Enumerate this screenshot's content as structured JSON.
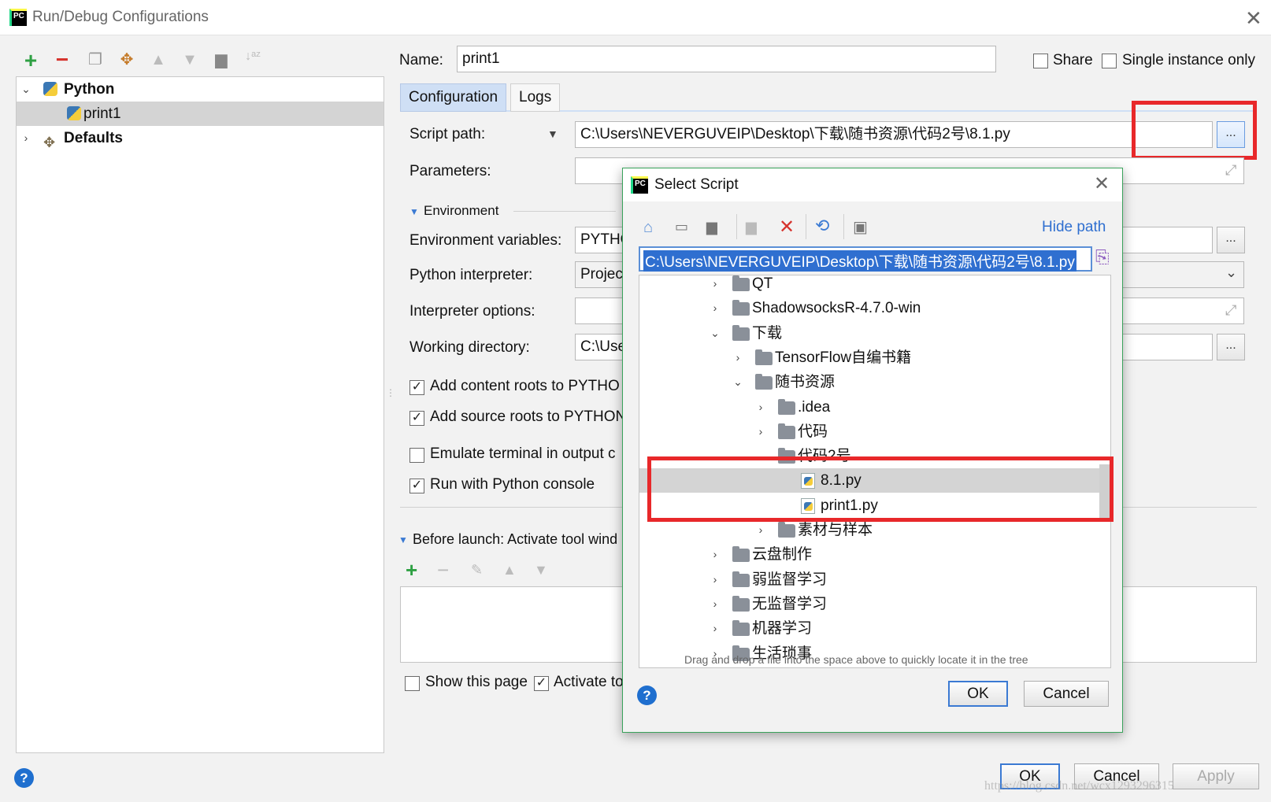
{
  "window": {
    "title": "Run/Debug Configurations"
  },
  "toolbar": {
    "icons": [
      "add-icon",
      "remove-icon",
      "copy-icon",
      "wrench-icon",
      "move-up-icon",
      "move-down-icon",
      "folder-icon",
      "sort-icon"
    ]
  },
  "tree": {
    "python": "Python",
    "print1": "print1",
    "defaults": "Defaults"
  },
  "name": {
    "label": "Name:",
    "value": "print1"
  },
  "share": {
    "label": "Share"
  },
  "single_instance": {
    "label": "Single instance only"
  },
  "tabs": {
    "configuration": "Configuration",
    "logs": "Logs"
  },
  "form": {
    "script_path_label": "Script path:",
    "script_path_value": "C:\\Users\\NEVERGUVEIP\\Desktop\\下载\\随书资源\\代码2号\\8.1.py",
    "parameters_label": "Parameters:",
    "environment_label": "Environment",
    "env_vars_label": "Environment variables:",
    "env_vars_value": "PYTHO",
    "interpreter_label": "Python interpreter:",
    "interpreter_value": "Projec",
    "interp_options_label": "Interpreter options:",
    "working_dir_label": "Working directory:",
    "working_dir_value": "C:\\Use",
    "add_content_roots": "Add content roots to PYTHO",
    "add_source_roots": "Add source roots to PYTHON",
    "emulate_terminal": "Emulate terminal in output c",
    "run_with_console": "Run with Python console",
    "before_launch": "Before launch: Activate tool wind",
    "show_this_page": "Show this page",
    "activate_tool": "Activate to"
  },
  "buttons": {
    "ok": "OK",
    "cancel": "Cancel",
    "apply": "Apply",
    "dots": "..."
  },
  "watermark": "https://blog.csdn.net/wcx1293296315",
  "dialog": {
    "title": "Select Script",
    "hide_path": "Hide path",
    "path_value": "C:\\Users\\NEVERGUVEIP\\Desktop\\下载\\随书资源\\代码2号\\8.1.py",
    "hint": "Drag and drop a file into the space above to quickly locate it in the tree",
    "ok": "OK",
    "cancel": "Cancel",
    "rows": [
      {
        "label": "QT",
        "type": "folder",
        "depth": 0,
        "state": "collapsed"
      },
      {
        "label": "ShadowsocksR-4.7.0-win",
        "type": "folder",
        "depth": 0,
        "state": "collapsed"
      },
      {
        "label": "下载",
        "type": "folder",
        "depth": 0,
        "state": "expanded"
      },
      {
        "label": "TensorFlow自编书籍",
        "type": "folder",
        "depth": 1,
        "state": "collapsed"
      },
      {
        "label": "随书资源",
        "type": "folder",
        "depth": 1,
        "state": "expanded"
      },
      {
        "label": ".idea",
        "type": "folder",
        "depth": 2,
        "state": "collapsed"
      },
      {
        "label": "代码",
        "type": "folder",
        "depth": 2,
        "state": "collapsed"
      },
      {
        "label": "代码2号",
        "type": "folder",
        "depth": 2,
        "state": "expanded"
      },
      {
        "label": "8.1.py",
        "type": "file",
        "depth": 3,
        "state": "selected"
      },
      {
        "label": "print1.py",
        "type": "file",
        "depth": 3,
        "state": "none"
      },
      {
        "label": "素材与样本",
        "type": "folder",
        "depth": 2,
        "state": "collapsed"
      },
      {
        "label": "云盘制作",
        "type": "folder",
        "depth": 0,
        "state": "collapsed"
      },
      {
        "label": "弱监督学习",
        "type": "folder",
        "depth": 0,
        "state": "collapsed"
      },
      {
        "label": "无监督学习",
        "type": "folder",
        "depth": 0,
        "state": "collapsed"
      },
      {
        "label": "机器学习",
        "type": "folder",
        "depth": 0,
        "state": "collapsed"
      },
      {
        "label": "生活琐事",
        "type": "folder",
        "depth": 0,
        "state": "collapsed"
      }
    ]
  },
  "colors": {
    "highlight_box": "#e8282a",
    "accent": "#3b7ad3",
    "selection": "#d4d4d4",
    "dialog_border": "#39a35b",
    "tab_active": "#cfdff5"
  }
}
